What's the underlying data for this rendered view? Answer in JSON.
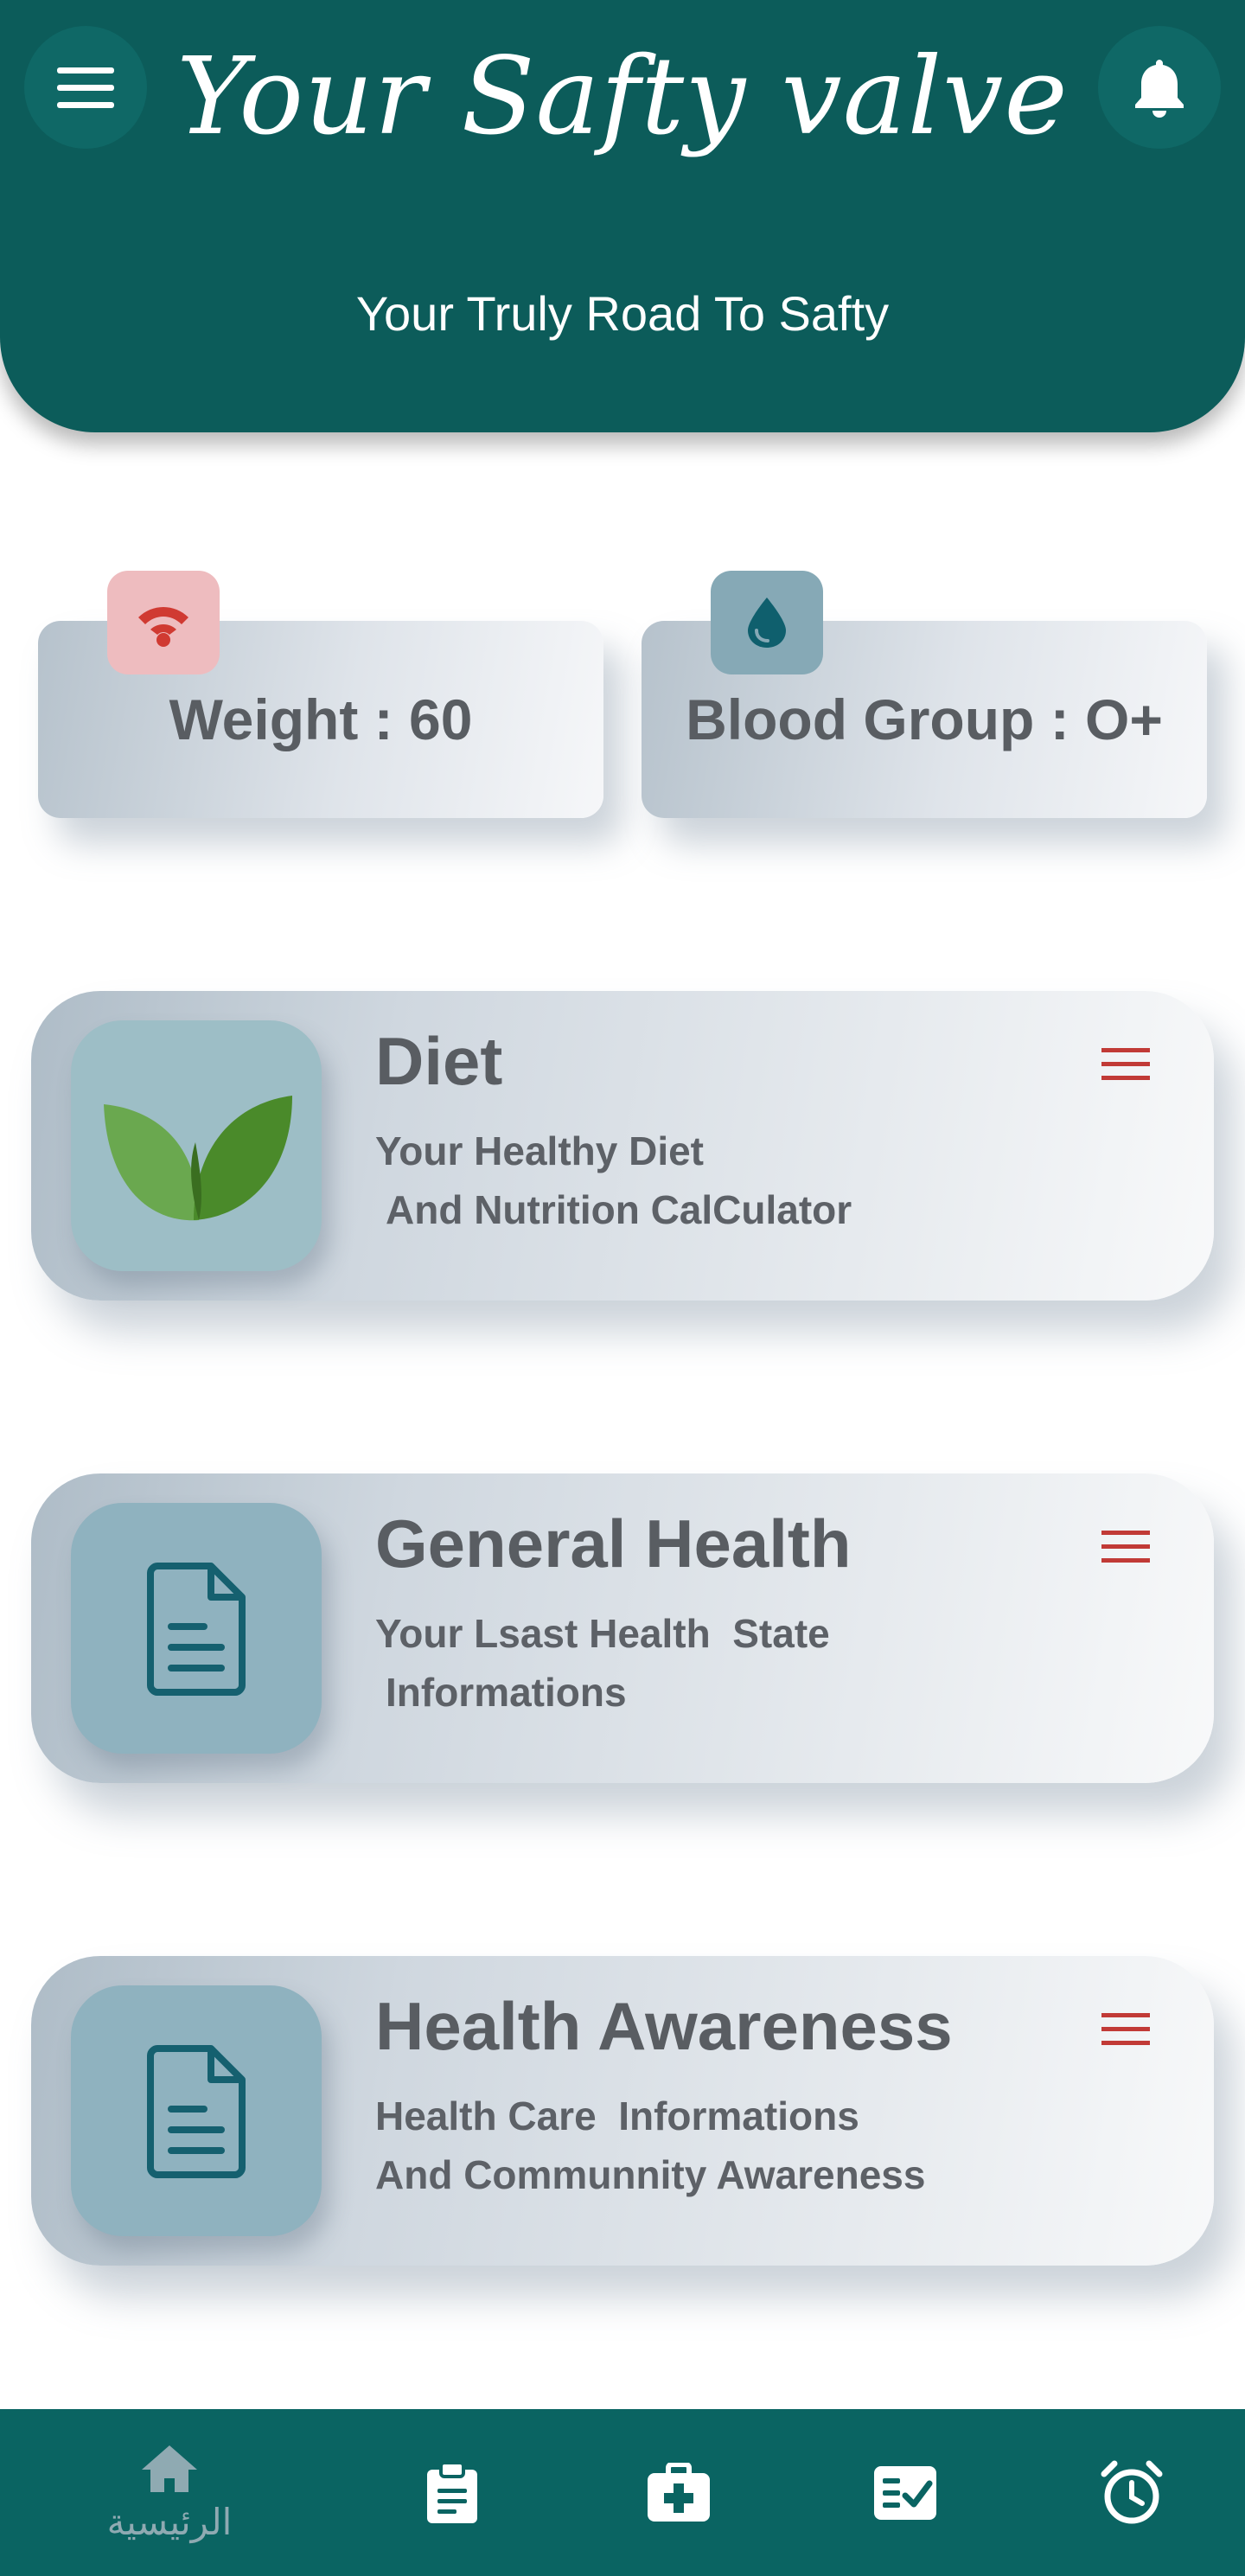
{
  "header": {
    "title": "Your Safty valve",
    "tagline": "Your Truly Road To Safty",
    "menu_icon": "hamburger-menu-icon",
    "bell_icon": "bell-icon",
    "background_color": "#0c5c5a"
  },
  "stats": [
    {
      "label": "Weight",
      "separator": ":",
      "value": "60",
      "icon": "wifi-icon",
      "icon_color": "#d03a32"
    },
    {
      "label": "Blood Group",
      "separator": ":",
      "value": "O+",
      "icon": "drop-icon",
      "icon_color": "#0f5f6d"
    }
  ],
  "cards": [
    {
      "title": "Diet",
      "line1": "Your Healthy Diet",
      "line2": "And Nutrition CalCulator",
      "icon": "leaf-icon"
    },
    {
      "title": "General Health",
      "line1": "Your Lsast Health  State",
      "line2": "Informations",
      "icon": "document-icon"
    },
    {
      "title": "Health Awareness",
      "line1": "Health Care  Informations",
      "line2": "And Communnity Awareness",
      "icon": "document-icon"
    }
  ],
  "card_menu_icon_color": "#c13a36",
  "bottom_nav": {
    "background_color": "#0a6462",
    "items": [
      {
        "name": "home",
        "label": "الرئيسية",
        "icon": "home-icon",
        "active": true
      },
      {
        "name": "notes",
        "label": "",
        "icon": "clipboard-icon"
      },
      {
        "name": "medical",
        "label": "",
        "icon": "medical-kit-icon"
      },
      {
        "name": "tasks",
        "label": "",
        "icon": "checklist-icon"
      },
      {
        "name": "alarm",
        "label": "",
        "icon": "alarm-clock-icon"
      }
    ]
  }
}
